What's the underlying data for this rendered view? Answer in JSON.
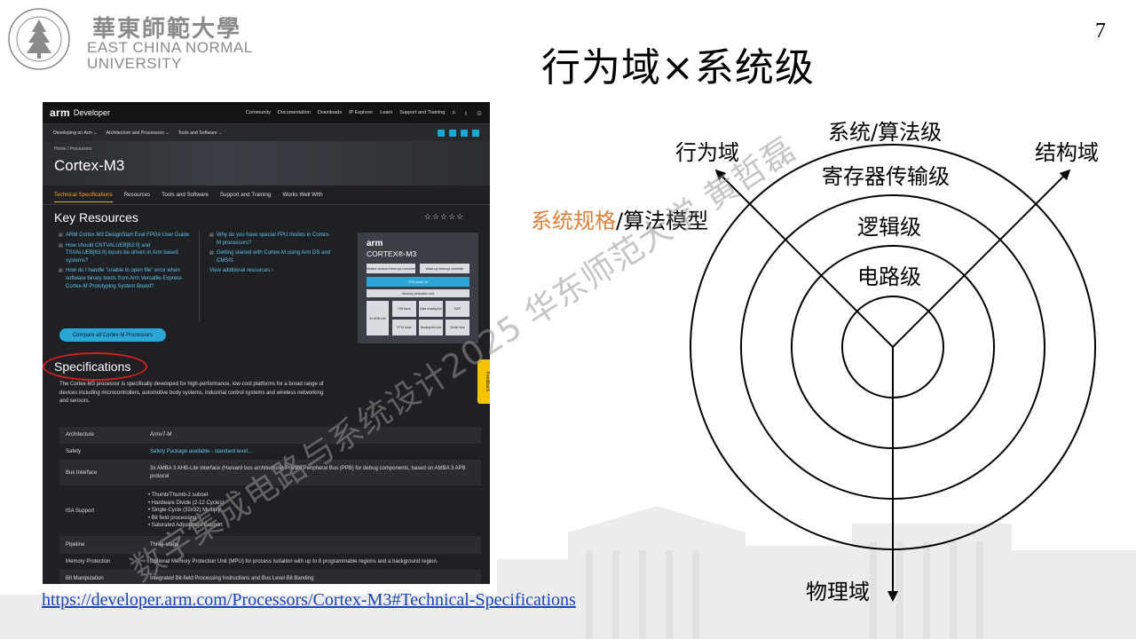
{
  "page_number": "7",
  "slide_title": "行为域×系统级",
  "logo": {
    "name_cn": "華東師範大學",
    "name_en_line1": "EAST CHINA NORMAL",
    "name_en_line2": "UNIVERSITY",
    "seal_text": "EAST CHINA NORMAL UNIVERSITY"
  },
  "arm_page": {
    "brand": "arm",
    "brand_suffix": "Developer",
    "top_nav": [
      "Community",
      "Documentation",
      "Downloads",
      "IP Explorer",
      "Learn",
      "Support and Training"
    ],
    "sub_nav": [
      "Developing on Arm ⌄",
      "Architecture and Processors ⌄",
      "Tools and Software ⌄"
    ],
    "breadcrumb": "Home  /  Processors",
    "title": "Cortex-M3",
    "tabs": [
      "Technical Specifications",
      "Resources",
      "Tools and Software",
      "Support and Training",
      "Works Well With"
    ],
    "key_resources_title": "Key Resources",
    "rating": "☆☆☆☆☆",
    "resources_col1": [
      "ARM Cortex-M3 DesignStart Eval FPGA User Guide",
      "How should CNTVALUEB[63:0] and TSVALUEB[63:0] inputs be driven in Arm based systems?",
      "How do I handle \"unable to open file\" error when software binary boots from Arm Versatile Express Cortex-M Prototyping System Board?"
    ],
    "resources_col2": [
      "Why do you have special FPU modes in Cortex-M processors?",
      "Getting started with Cortex-M using Arm DS and CMSIS"
    ],
    "view_additional": "View additional resources  ›",
    "compare_button": "Compare all Cortex-M Processors",
    "card": {
      "brand": "arm",
      "name": "CORTEX®-M3",
      "blocks": {
        "nvic": "Nested vectored interrupt controller",
        "wic": "Wake-up interrupt controller",
        "cpu": "CPU Armv7-M",
        "mpu": "Memory protection unit",
        "bus": "3x AHB-Lite",
        "itm": "ITM trace",
        "dwt": "Data watchpoint",
        "dap": "DAP",
        "etm": "ETM trace",
        "bkpt": "Breakpoint unit",
        "swv": "Serial wire"
      }
    },
    "specifications_title": "Specifications",
    "spec_description": "The Cortex-M3 processor is specifically developed for high-performance, low-cost platforms for a broad range of devices including microcontrollers, automotive body systems, industrial control systems and wireless networking and sensors.",
    "feedback_tab": "Feedback",
    "spec_table": [
      {
        "key": "Architecture",
        "value": "Armv7-M"
      },
      {
        "key": "Safety",
        "value": "Safety Package available - standard level..."
      },
      {
        "key": "Bus Interface",
        "value": "3x AMBA 3 AHB-Lite interface (Harvard bus architecture) Private Peripheral Bus (PPB) for debug components, based on AMBA 3 APB protocol"
      },
      {
        "key": "ISA Support",
        "value": "• Thumb/Thumb-2 subset\n• Hardware Divide (2-12 Cycles)\n• Single-Cycle (32x32) Multiply\n• Bit field processing\n• Saturated Adjustment Support"
      },
      {
        "key": "Pipeline",
        "value": "Three-stage"
      },
      {
        "key": "Memory Protection",
        "value": "Optional Memory Protection Unit (MPU) for process isolation with up to 8 programmable regions and a background region."
      },
      {
        "key": "Bit Manipulation",
        "value": "Integrated Bit-field Processing Instructions and Bus Level Bit Banding"
      }
    ]
  },
  "source_url": "https://developer.arm.com/Processors/Cortex-M3#Technical-Specifications",
  "diagram": {
    "axis_behavior": "行为域",
    "axis_structure": "结构域",
    "axis_physical": "物理域",
    "level_system": "系统/算法级",
    "level_register": "寄存器传输级",
    "level_logic": "逻辑级",
    "level_circuit": "电路级",
    "spec_prefix": "系统规格",
    "spec_suffix": "/算法模型"
  },
  "watermark": "数字集成电路与系统设计2025 华东师范大学 黄哲磊"
}
